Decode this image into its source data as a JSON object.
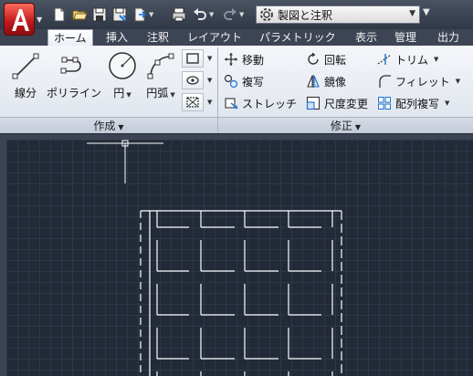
{
  "quick_access": {
    "icons": [
      "new-icon",
      "open-icon",
      "save-icon",
      "save-as-icon",
      "publish-icon",
      "plot-icon",
      "undo-icon",
      "redo-icon"
    ],
    "workspace_label": "製図と注釈"
  },
  "tabs": [
    {
      "label": "ホーム",
      "active": true
    },
    {
      "label": "挿入"
    },
    {
      "label": "注釈"
    },
    {
      "label": "レイアウト"
    },
    {
      "label": "パラメトリック"
    },
    {
      "label": "表示"
    },
    {
      "label": "管理"
    },
    {
      "label": "出力"
    }
  ],
  "draw_panel": {
    "title": "作成",
    "tools": [
      {
        "label": "線分",
        "icon": "line-icon"
      },
      {
        "label": "ポリライン",
        "icon": "polyline-icon"
      },
      {
        "label": "円",
        "icon": "circle-icon"
      },
      {
        "label": "円弧",
        "icon": "arc-icon"
      }
    ],
    "small_tools": [
      "rectangle-icon",
      "hatch-icon",
      "boundary-icon"
    ]
  },
  "modify_panel": {
    "title": "修正",
    "tools": [
      {
        "label": "移動",
        "icon": "move-icon"
      },
      {
        "label": "回転",
        "icon": "rotate-icon"
      },
      {
        "label": "トリム",
        "icon": "trim-icon",
        "dropdown": true
      },
      {
        "label": "複写",
        "icon": "copy-icon"
      },
      {
        "label": "鏡像",
        "icon": "mirror-icon"
      },
      {
        "label": "フィレット",
        "icon": "fillet-icon",
        "dropdown": true
      },
      {
        "label": "ストレッチ",
        "icon": "stretch-icon"
      },
      {
        "label": "尺度変更",
        "icon": "scale-icon"
      },
      {
        "label": "配列複写",
        "icon": "array-icon",
        "dropdown": true
      }
    ]
  },
  "colors": {
    "canvas_bg": "#222a38",
    "grid": "#2e3747",
    "geometry": "#ffffff",
    "title_bar": "#3d4555"
  }
}
